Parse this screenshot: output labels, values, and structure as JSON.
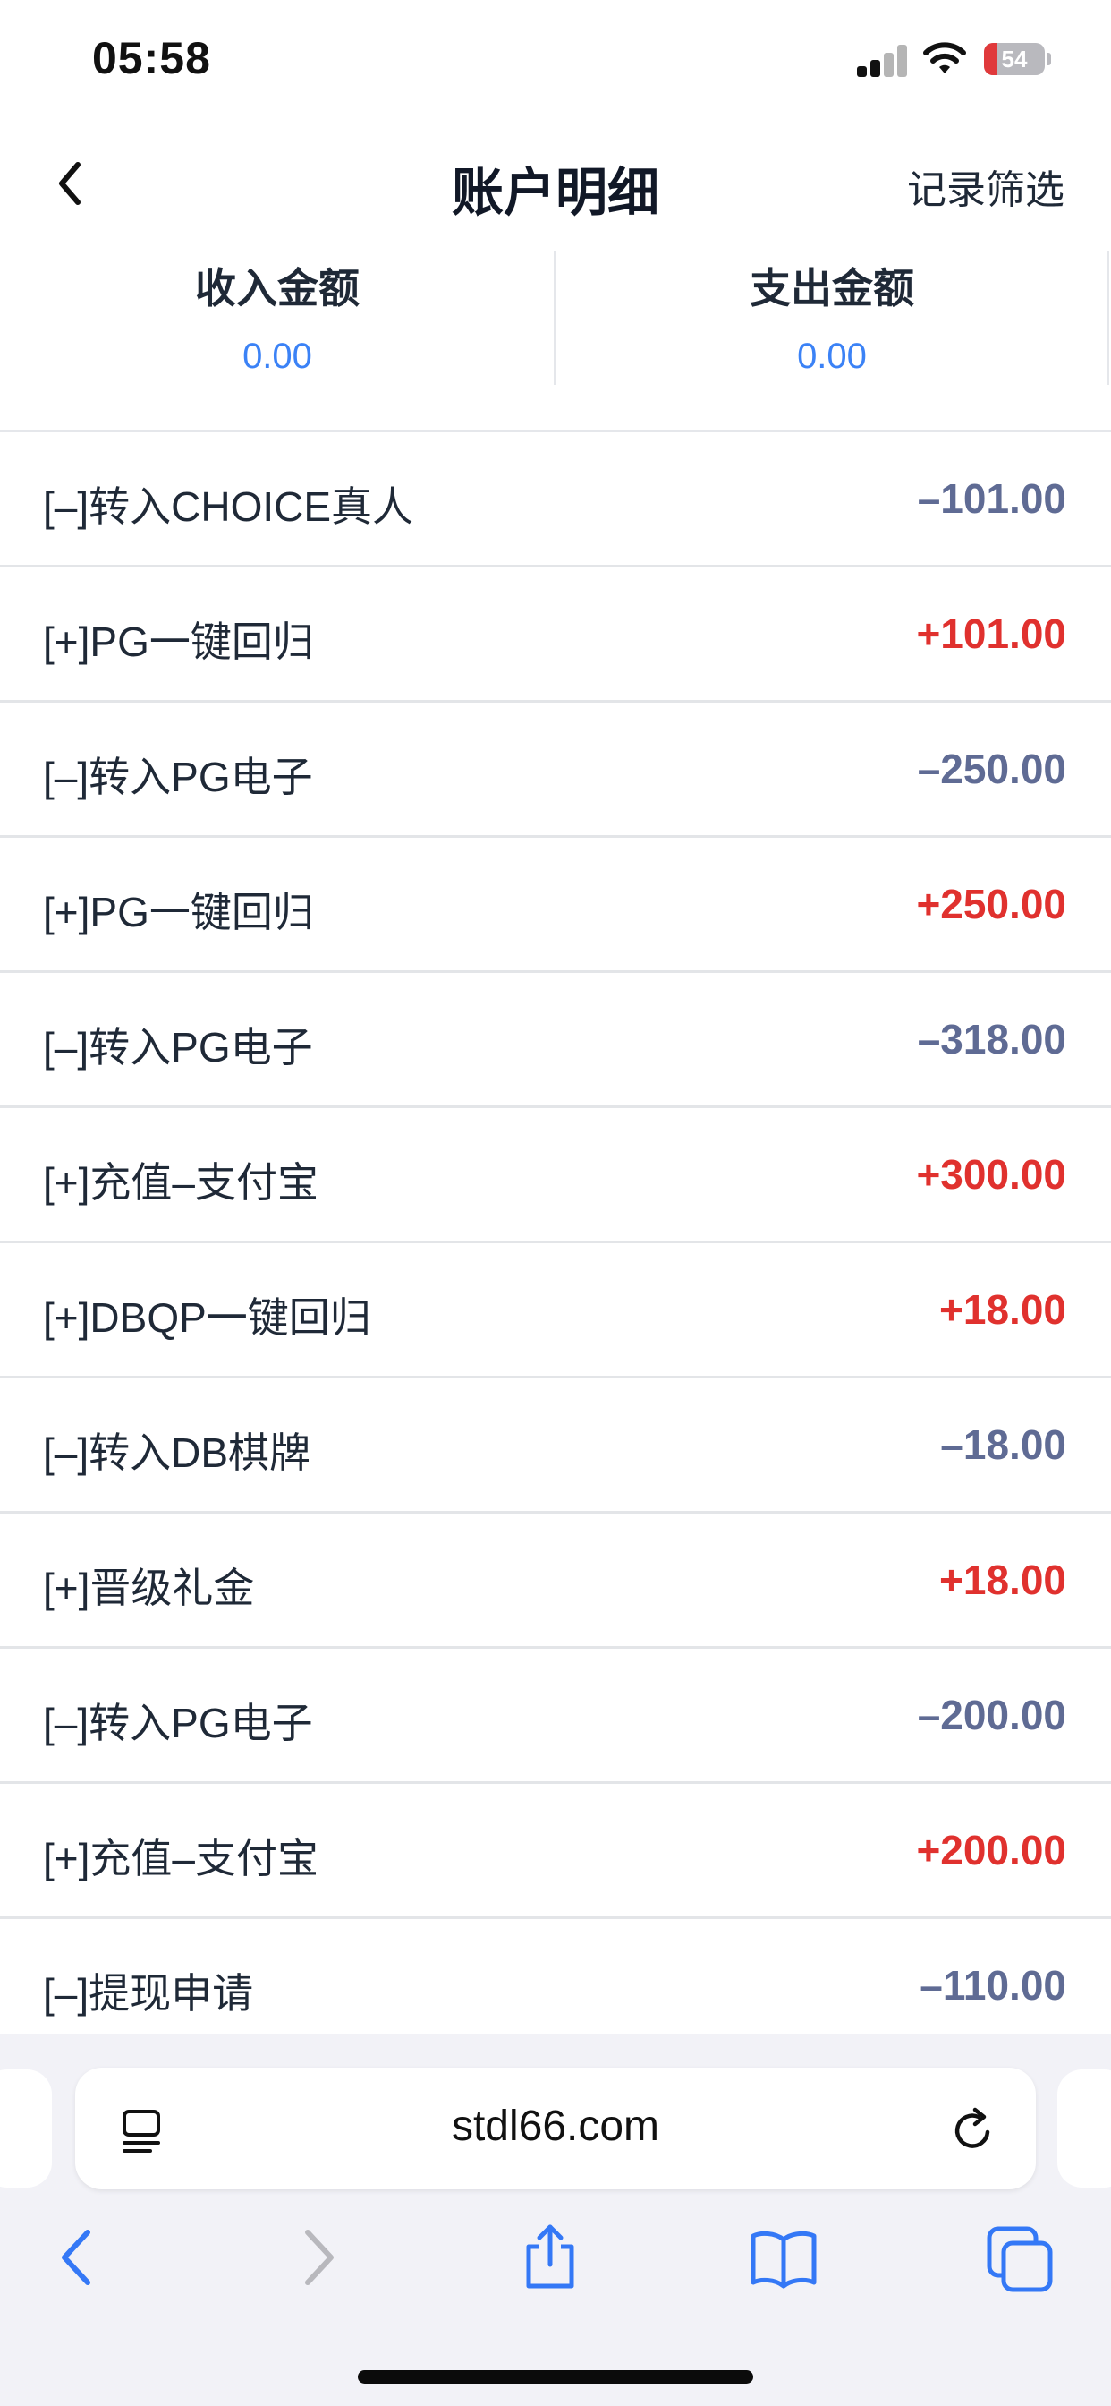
{
  "status_bar": {
    "time": "05:58",
    "battery_level": "54",
    "signal_icon": "cellular-signal-icon",
    "wifi_icon": "wifi-icon",
    "battery_icon": "battery-icon"
  },
  "nav": {
    "back_icon": "chevron-left-icon",
    "title": "账户明细",
    "filter_label": "记录筛选"
  },
  "summary": {
    "income_label": "收入金额",
    "income_value": "0.00",
    "expense_label": "支出金额",
    "expense_value": "0.00"
  },
  "transactions": [
    {
      "label": "[–]转入CHOICE真人",
      "amount": "–101.00",
      "type": "negative"
    },
    {
      "label": "[+]PG一键回归",
      "amount": "+101.00",
      "type": "positive"
    },
    {
      "label": "[–]转入PG电子",
      "amount": "–250.00",
      "type": "negative"
    },
    {
      "label": "[+]PG一键回归",
      "amount": "+250.00",
      "type": "positive"
    },
    {
      "label": "[–]转入PG电子",
      "amount": "–318.00",
      "type": "negative"
    },
    {
      "label": "[+]充值–支付宝",
      "amount": "+300.00",
      "type": "positive"
    },
    {
      "label": "[+]DBQP一键回归",
      "amount": "+18.00",
      "type": "positive"
    },
    {
      "label": "[–]转入DB棋牌",
      "amount": "–18.00",
      "type": "negative"
    },
    {
      "label": "[+]晋级礼金",
      "amount": "+18.00",
      "type": "positive"
    },
    {
      "label": "[–]转入PG电子",
      "amount": "–200.00",
      "type": "negative"
    },
    {
      "label": "[+]充值–支付宝",
      "amount": "+200.00",
      "type": "positive"
    },
    {
      "label": "[–]提现申请",
      "amount": "–110.00",
      "type": "negative"
    }
  ],
  "colors": {
    "positive": "#e0312e",
    "negative": "#5f6b94",
    "accent": "#3b82f6"
  },
  "browser": {
    "url": "stdl66.com",
    "reader_icon": "reader-mode-icon",
    "reload_icon": "reload-icon",
    "toolbar": [
      "back-arrow-icon",
      "forward-arrow-icon",
      "share-icon",
      "bookmarks-icon",
      "tabs-icon"
    ]
  }
}
